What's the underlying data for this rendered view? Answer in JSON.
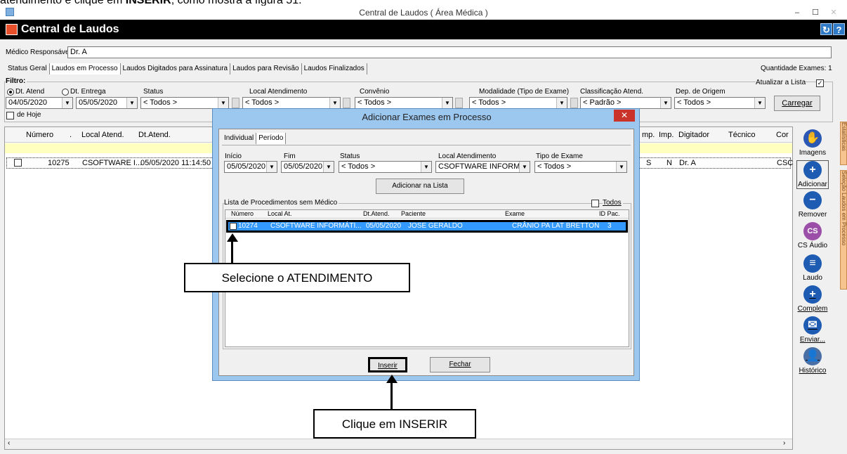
{
  "top_text": {
    "prefix": "atendimento e clique em ",
    "bold": "INSERIR",
    "suffix": ", como mostra a figura 51."
  },
  "window": {
    "title": "Central de Laudos ( Área Médica )",
    "min": "–",
    "max": "☐",
    "close": "✕"
  },
  "app": {
    "title": "Central de Laudos",
    "btn1": "↻",
    "btn2": "?"
  },
  "medico": {
    "label": "Médico Responsável:",
    "value": "Dr. A"
  },
  "tabs": [
    "Status Geral",
    "Laudos em Processo",
    "Laudos Digitados para Assinatura",
    "Laudos para Revisão",
    "Laudos Finalizados"
  ],
  "quantidade": "Quantidade Exames: 1",
  "atualizar": "Atualizar a Lista",
  "filtro": {
    "label": "Filtro:",
    "dt_atend": "Dt. Atend",
    "dt_entrega": "Dt. Entrega",
    "date_from": "04/05/2020",
    "date_to": "05/05/2020",
    "de_hoje": "de Hoje",
    "status_label": "Status",
    "status_value": "< Todos >",
    "local_label": "Local Atendimento",
    "local_value": "< Todos >",
    "convenio_label": "Convênio",
    "convenio_value": "< Todos >",
    "modalidade_label": "Modalidade (Tipo de Exame)",
    "modalidade_value": "< Todos >",
    "classificacao_label": "Classificação Atend.",
    "classificacao_value": "< Padrão >",
    "dep_label": "Dep. de Origem",
    "dep_value": "< Todos >",
    "carregar": "Carregar"
  },
  "grid": {
    "headers": [
      "Número",
      ".",
      "Local Atend.",
      "Dt.Atend.",
      "mp.",
      "Imp.",
      "Digitador",
      "Técnico",
      "Cor"
    ],
    "row": {
      "numero": "10275",
      "local": "CSOFTWARE I...",
      "dt": "05/05/2020 11:14:50",
      "s": "S",
      "n": "N",
      "digitador": "Dr. A",
      "cor": "CSC"
    }
  },
  "side": [
    "Imagens",
    "Adicionar",
    "Remover",
    "CS Áudio",
    "Laudo",
    "Complem",
    "Enviar...",
    "Histórico"
  ],
  "side_tabs": [
    "Estatísticas",
    "Seleção Laudos em Processo"
  ],
  "dialog": {
    "title": "Adicionar Exames em Processo",
    "close": "✕",
    "tabs": [
      "Individual",
      "Período"
    ],
    "inicio_label": "Início",
    "inicio_value": "05/05/2020",
    "fim_label": "Fim",
    "fim_value": "05/05/2020",
    "status_label": "Status",
    "status_value": "< Todos >",
    "local_label": "Local Atendimento",
    "local_value": "CSOFTWARE INFORMÁTI",
    "tipo_label": "Tipo de Exame",
    "tipo_value": "< Todos >",
    "adicionar": "Adicionar na Lista",
    "lista_label": "Lista de Procedimentos sem Médico",
    "todos": "Todos",
    "headers": [
      "Número",
      "Local At.",
      "Dt.Atend.",
      "Paciente",
      "Exame",
      "ID Pac."
    ],
    "row": {
      "numero": "10274",
      "local": "CSOFTWARE INFORMÁTI...",
      "dt": "05/05/2020",
      "paciente": "JOSE GERALDO",
      "exame": "CRÂNIO PA LAT BRETTON",
      "id": "3"
    },
    "inserir": "Inserir",
    "fechar": "Fechar"
  },
  "callouts": {
    "selecione": "Selecione o ATENDIMENTO",
    "clique": "Clique em INSERIR"
  },
  "colors": {
    "selection": "#3399ff",
    "dialog_frame": "#9cc7ef",
    "close_red": "#c9332a"
  }
}
